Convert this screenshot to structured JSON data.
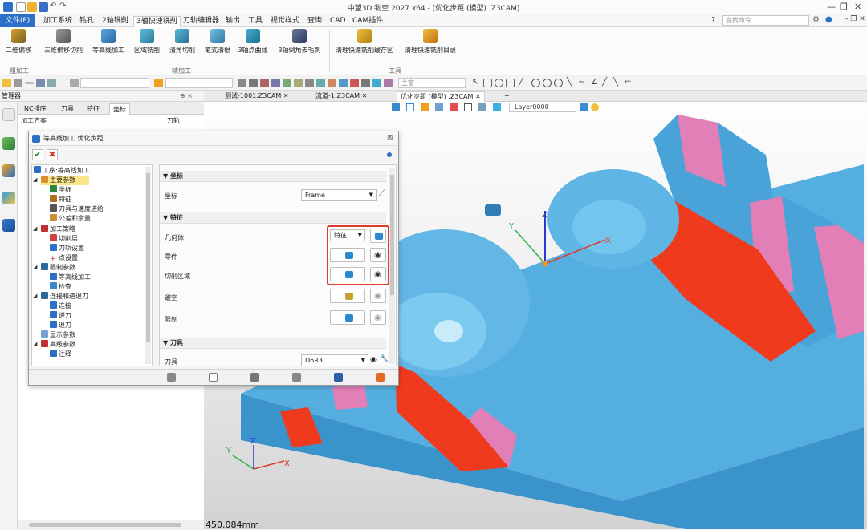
{
  "window": {
    "title": "中望3D 物空 2027 x64 - [优化步距 (模型) .Z3CAM]"
  },
  "search": {
    "placeholder": "查找命令"
  },
  "menu": {
    "items": [
      "文件(F)",
      "加工系统",
      "钻孔",
      "2轴铣削",
      "3轴快速铣削",
      "刀轨编辑器",
      "输出",
      "工具",
      "视觉样式",
      "查询",
      "CAD",
      "CAM插件"
    ],
    "active": "3轴快速铣削"
  },
  "ribbon": {
    "buttons": [
      "二维偏移",
      "三维偏移切削",
      "等高线加工",
      "区域铣削",
      "清角切削",
      "笔式清根",
      "3轴点曲线",
      "3轴倒角去毛刺",
      "清理快速铣削缓存区",
      "清理快速铣削目录"
    ],
    "groups": [
      "粗加工",
      "精加工",
      "工具"
    ]
  },
  "toolbar": {
    "combo_main": "主窗",
    "layer": "Layer0000"
  },
  "manager": {
    "title": "管理器",
    "pin": "⊕ ×"
  },
  "left_tabs": [
    "NC排序",
    "刀具",
    "特征",
    "坐标"
  ],
  "left_tab_active": "坐标",
  "left_columns": {
    "name": "加工方案",
    "path": "刀轨"
  },
  "doc_tabs": [
    "测试-1001.Z3CAM",
    "流道-1.Z3CAM",
    "优化步距 (模型) .Z3CAM"
  ],
  "doc_tab_active": "优化步距 (模型) .Z3CAM",
  "scale": "450.084mm",
  "dialog": {
    "title": "等高线加工 优化步距",
    "tree": [
      {
        "label": "工序:等高线加工",
        "level": 0
      },
      {
        "label": "主要参数",
        "level": 1,
        "selected": true
      },
      {
        "label": "坐标",
        "level": 2
      },
      {
        "label": "特征",
        "level": 2
      },
      {
        "label": "刀具与速度进给",
        "level": 2
      },
      {
        "label": "公差和余量",
        "level": 2
      },
      {
        "label": "加工策略",
        "level": 1
      },
      {
        "label": "切削层",
        "level": 2
      },
      {
        "label": "刀轨设置",
        "level": 2
      },
      {
        "label": "点设置",
        "level": 2
      },
      {
        "label": "限制参数",
        "level": 1
      },
      {
        "label": "等高线加工",
        "level": 2
      },
      {
        "label": "检查",
        "level": 2
      },
      {
        "label": "连接和进退刀",
        "level": 1
      },
      {
        "label": "连接",
        "level": 2
      },
      {
        "label": "进刀",
        "level": 2
      },
      {
        "label": "退刀",
        "level": 2
      },
      {
        "label": "显示参数",
        "level": 1
      },
      {
        "label": "高级参数",
        "level": 1
      },
      {
        "label": "注释",
        "level": 2
      }
    ],
    "sections": {
      "coord": {
        "title": "坐标",
        "label": "坐标",
        "value": "Frame"
      },
      "feature": {
        "title": "特征",
        "geometry": "几何体",
        "geometry_value": "特征",
        "part": "零件",
        "cut_region": "切削区域",
        "avoid": "避空",
        "limit": "限制"
      },
      "tool": {
        "title": "刀具",
        "label": "刀具",
        "value": "D6R3"
      }
    }
  },
  "colors": {
    "accent": "#2b6fc6",
    "highlight": "#e13b2d",
    "part_blue": "#4aa3d8",
    "part_pink": "#e27fb7",
    "floor_red": "#f03a1e"
  },
  "axis_labels": {
    "x": "X",
    "y": "Y",
    "z": "Z"
  }
}
